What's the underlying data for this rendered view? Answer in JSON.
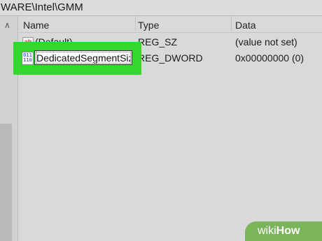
{
  "address_bar": {
    "path": "WARE\\Intel\\GMM"
  },
  "columns": {
    "name": "Name",
    "type": "Type",
    "data": "Data"
  },
  "rows": [
    {
      "name": "(Default)",
      "type": "REG_SZ",
      "data": "(value not set)",
      "icon": "string-value-icon"
    },
    {
      "name": "DedicatedSegmentSize",
      "type": "REG_DWORD",
      "data": "0x00000000 (0)",
      "icon": "binary-value-icon"
    }
  ],
  "rename_field": {
    "value": "DedicatedSegmentSize"
  },
  "icons": {
    "string_value": "ab",
    "binary_value": "011 110"
  },
  "watermark": {
    "wiki": "wiki",
    "how": "How"
  },
  "colors": {
    "highlight": "#32d82b",
    "watermark": "#7bb55a"
  }
}
